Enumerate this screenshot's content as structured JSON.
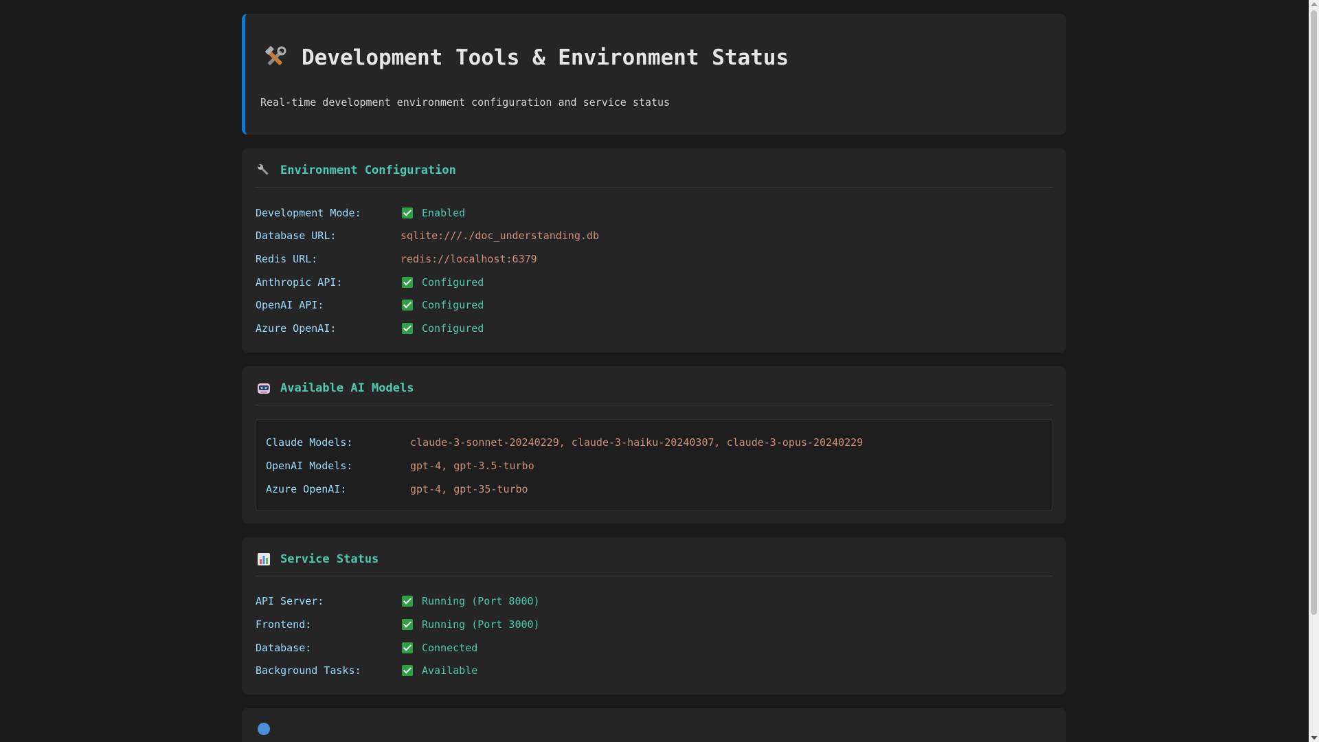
{
  "header": {
    "icon": "tools-icon",
    "title": "Development Tools & Environment Status",
    "subtitle": "Real-time development environment configuration and service status"
  },
  "environment": {
    "icon": "wrench-icon",
    "title": "Environment Configuration",
    "rows": [
      {
        "label": "Development Mode:",
        "value": "Enabled",
        "status": "ok"
      },
      {
        "label": "Database URL:",
        "value": "sqlite:///./doc_understanding.db",
        "status": "url"
      },
      {
        "label": "Redis URL:",
        "value": "redis://localhost:6379",
        "status": "url"
      },
      {
        "label": "Anthropic API:",
        "value": "Configured",
        "status": "ok"
      },
      {
        "label": "OpenAI API:",
        "value": "Configured",
        "status": "ok"
      },
      {
        "label": "Azure OpenAI:",
        "value": "Configured",
        "status": "ok"
      }
    ]
  },
  "models": {
    "icon": "robot-icon",
    "title": "Available AI Models",
    "rows": [
      {
        "label": "Claude Models:",
        "value": "claude-3-sonnet-20240229, claude-3-haiku-20240307, claude-3-opus-20240229"
      },
      {
        "label": "OpenAI Models:",
        "value": "gpt-4, gpt-3.5-turbo"
      },
      {
        "label": "Azure OpenAI:",
        "value": "gpt-4, gpt-35-turbo"
      }
    ]
  },
  "services": {
    "icon": "bar-chart-icon",
    "title": "Service Status",
    "rows": [
      {
        "label": "API Server:",
        "value": "Running (Port 8000)",
        "status": "ok"
      },
      {
        "label": "Frontend:",
        "value": "Running (Port 3000)",
        "status": "ok"
      },
      {
        "label": "Database:",
        "value": "Connected",
        "status": "ok"
      },
      {
        "label": "Background Tasks:",
        "value": "Available",
        "status": "ok"
      }
    ]
  },
  "colors": {
    "background": "#1a1a1a",
    "card": "#252526",
    "accent_border": "#0e7ad3",
    "section_title": "#4ec9b0",
    "label": "#9cdcfe",
    "value_url": "#ce9178",
    "value_ok": "#4ec9b0",
    "check": "#2ea043"
  }
}
